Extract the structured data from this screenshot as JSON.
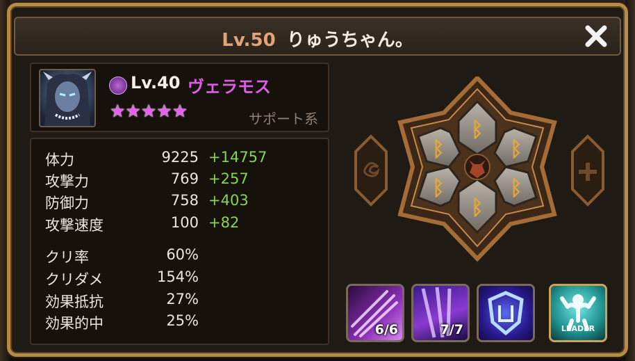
{
  "header": {
    "player_level": "Lv.50",
    "player_name": "りゅうちゃん。"
  },
  "monster": {
    "element_icon": "dark-element-icon",
    "level": "Lv.40",
    "name": "ヴェラモス",
    "stars": 5,
    "star_glyph": "★",
    "role": "サポート系",
    "name_color": "#e15de8"
  },
  "stats": [
    {
      "label": "体力",
      "value": "9225",
      "bonus": "+14757"
    },
    {
      "label": "攻撃力",
      "value": "769",
      "bonus": "+257"
    },
    {
      "label": "防御力",
      "value": "758",
      "bonus": "+403"
    },
    {
      "label": "攻撃速度",
      "value": "100",
      "bonus": "+82"
    },
    {
      "label": "クリ率",
      "value": "60%",
      "bonus": ""
    },
    {
      "label": "クリダメ",
      "value": "154%",
      "bonus": ""
    },
    {
      "label": "効果抵抗",
      "value": "27%",
      "bonus": ""
    },
    {
      "label": "効果的中",
      "value": "25%",
      "bonus": ""
    }
  ],
  "runes": {
    "slot_icon": "rune-b-icon",
    "glyph": "ᛒ",
    "slots": 6,
    "set_left": "swirl-set-icon",
    "set_right": "cross-set-icon",
    "center": "demon-face-icon"
  },
  "skills": [
    {
      "level": "6/6",
      "icon": "purple-slash-skill-icon"
    },
    {
      "level": "7/7",
      "icon": "purple-beam-skill-icon"
    },
    {
      "level": "",
      "icon": "blue-shield-skill-icon"
    }
  ],
  "leader": {
    "label": "LEADER",
    "icon": "leader-strength-icon"
  },
  "colors": {
    "frame_gold": "#b88b45",
    "bonus_green": "#89d64e",
    "player_level": "#e2a27a"
  }
}
